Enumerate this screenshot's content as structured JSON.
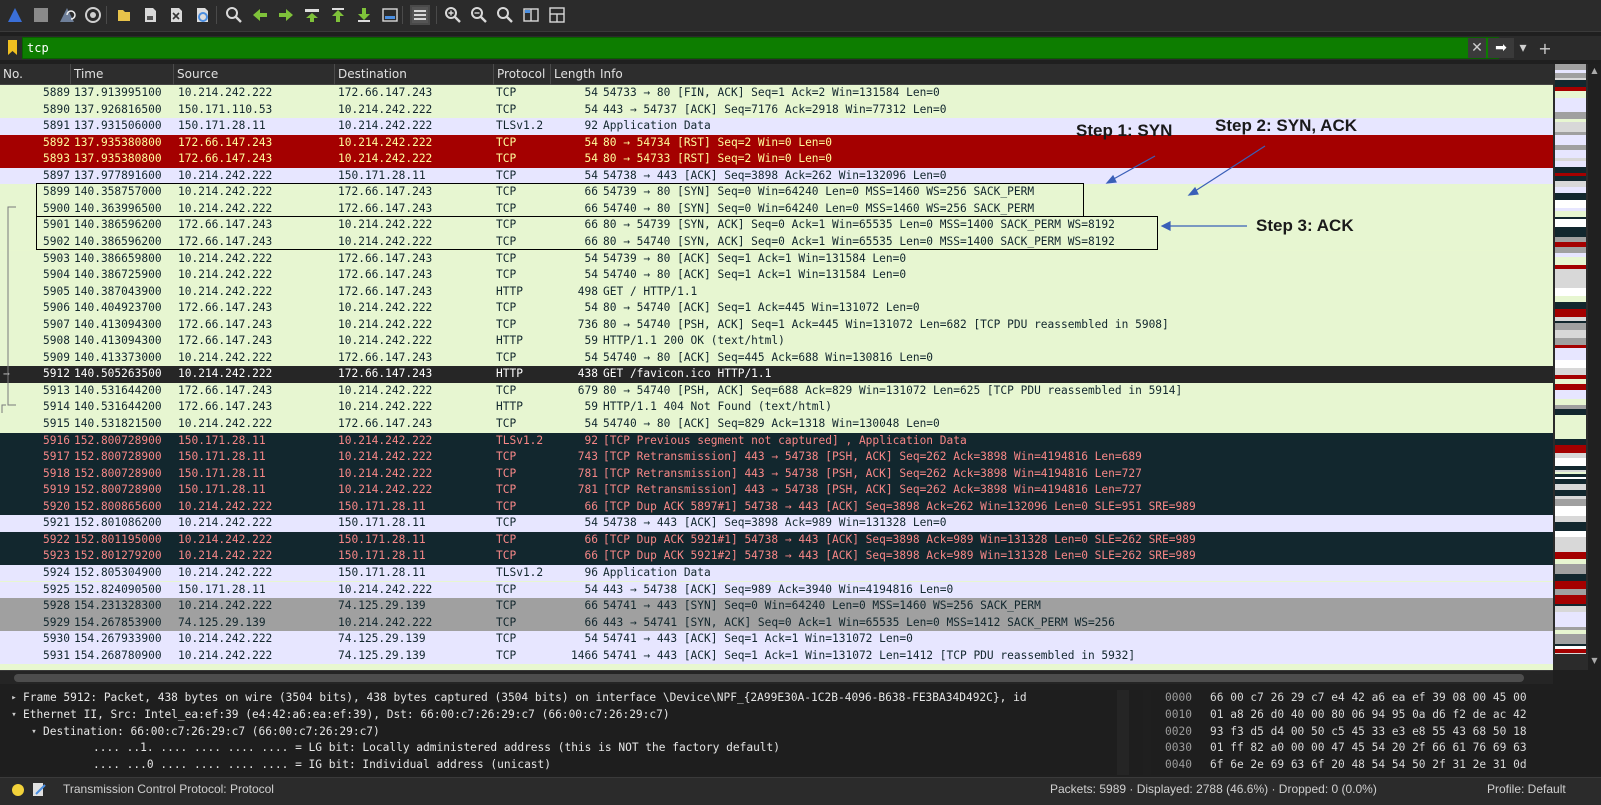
{
  "toolbar": {
    "buttons": [
      {
        "name": "start-capture-icon",
        "glyph": "",
        "color": "#3a6fd8"
      },
      {
        "name": "stop-capture-icon",
        "glyph": "",
        "color": "#8a8a8a"
      },
      {
        "name": "restart-capture-icon",
        "glyph": "",
        "color": "#6e7f9a"
      },
      {
        "name": "capture-options-icon",
        "glyph": "",
        "color": "#cfcfcf"
      },
      {
        "name": "open-file-icon",
        "glyph": "",
        "color": "#e8c34a"
      },
      {
        "name": "save-file-icon",
        "glyph": "",
        "color": "#d9d9d9"
      },
      {
        "name": "close-file-icon",
        "glyph": "",
        "color": "#d9d9d9"
      },
      {
        "name": "reload-file-icon",
        "glyph": "",
        "color": "#4a8ee0"
      },
      {
        "name": "find-packet-icon",
        "glyph": "",
        "color": "#d9d9d9"
      },
      {
        "name": "go-back-icon",
        "glyph": "",
        "color": "#7fc23a"
      },
      {
        "name": "go-forward-icon",
        "glyph": "",
        "color": "#7fc23a"
      },
      {
        "name": "go-to-packet-icon",
        "glyph": "",
        "color": "#7fc23a"
      },
      {
        "name": "go-first-packet-icon",
        "glyph": "",
        "color": "#7fc23a"
      },
      {
        "name": "go-last-packet-icon",
        "glyph": "",
        "color": "#7fc23a"
      },
      {
        "name": "auto-scroll-icon",
        "glyph": "",
        "color": "#d9d9d9"
      },
      {
        "name": "colorize-icon",
        "glyph": "",
        "color": "#d9d9d9"
      },
      {
        "name": "zoom-in-icon",
        "glyph": "",
        "color": "#d9d9d9"
      },
      {
        "name": "zoom-out-icon",
        "glyph": "",
        "color": "#d9d9d9"
      },
      {
        "name": "zoom-normal-icon",
        "glyph": "",
        "color": "#d9d9d9"
      },
      {
        "name": "resize-columns-icon",
        "glyph": "",
        "color": "#d9d9d9"
      },
      {
        "name": "layout-icon",
        "glyph": "",
        "color": "#d9d9d9"
      }
    ]
  },
  "filter": {
    "value": "tcp",
    "clear_glyph": "✕",
    "apply_glyph": "➡",
    "dropdown_glyph": "▾",
    "add_glyph": "+"
  },
  "columns": {
    "no": "No.",
    "time": "Time",
    "source": "Source",
    "destination": "Destination",
    "protocol": "Protocol",
    "length": "Length",
    "info": "Info"
  },
  "packets": [
    {
      "no": "5889",
      "time": "137.913995100",
      "src": "10.214.242.222",
      "dst": "172.66.147.243",
      "proto": "TCP",
      "len": "54",
      "info": "54733 → 80 [FIN, ACK] Seq=1 Ack=2 Win=131584 Len=0",
      "style": "tcp"
    },
    {
      "no": "5890",
      "time": "137.926816500",
      "src": "150.171.110.53",
      "dst": "10.214.242.222",
      "proto": "TCP",
      "len": "54",
      "info": "443 → 54737 [ACK] Seq=7176 Ack=2918 Win=77312 Len=0",
      "style": "tcp"
    },
    {
      "no": "5891",
      "time": "137.931506000",
      "src": "150.171.28.11",
      "dst": "10.214.242.222",
      "proto": "TLSv1.2",
      "len": "92",
      "info": "Application Data",
      "style": "tls"
    },
    {
      "no": "5892",
      "time": "137.935380800",
      "src": "172.66.147.243",
      "dst": "10.214.242.222",
      "proto": "TCP",
      "len": "54",
      "info": "80 → 54734 [RST] Seq=2 Win=0 Len=0",
      "style": "rst"
    },
    {
      "no": "5893",
      "time": "137.935380800",
      "src": "172.66.147.243",
      "dst": "10.214.242.222",
      "proto": "TCP",
      "len": "54",
      "info": "80 → 54733 [RST] Seq=2 Win=0 Len=0",
      "style": "rst"
    },
    {
      "no": "5897",
      "time": "137.977891600",
      "src": "10.214.242.222",
      "dst": "150.171.28.11",
      "proto": "TCP",
      "len": "54",
      "info": "54738 → 443 [ACK] Seq=3898 Ack=262 Win=132096 Len=0",
      "style": "tls"
    },
    {
      "no": "5899",
      "time": "140.358757000",
      "src": "10.214.242.222",
      "dst": "172.66.147.243",
      "proto": "TCP",
      "len": "66",
      "info": "54739 → 80 [SYN] Seq=0 Win=64240 Len=0 MSS=1460 WS=256 SACK_PERM",
      "style": "tcp"
    },
    {
      "no": "5900",
      "time": "140.363996500",
      "src": "10.214.242.222",
      "dst": "172.66.147.243",
      "proto": "TCP",
      "len": "66",
      "info": "54740 → 80 [SYN] Seq=0 Win=64240 Len=0 MSS=1460 WS=256 SACK_PERM",
      "style": "tcp"
    },
    {
      "no": "5901",
      "time": "140.386596200",
      "src": "172.66.147.243",
      "dst": "10.214.242.222",
      "proto": "TCP",
      "len": "66",
      "info": "80 → 54739 [SYN, ACK] Seq=0 Ack=1 Win=65535 Len=0 MSS=1400 SACK_PERM WS=8192",
      "style": "tcp"
    },
    {
      "no": "5902",
      "time": "140.386596200",
      "src": "172.66.147.243",
      "dst": "10.214.242.222",
      "proto": "TCP",
      "len": "66",
      "info": "80 → 54740 [SYN, ACK] Seq=0 Ack=1 Win=65535 Len=0 MSS=1400 SACK_PERM WS=8192",
      "style": "tcp"
    },
    {
      "no": "5903",
      "time": "140.386659800",
      "src": "10.214.242.222",
      "dst": "172.66.147.243",
      "proto": "TCP",
      "len": "54",
      "info": "54739 → 80 [ACK] Seq=1 Ack=1 Win=131584 Len=0",
      "style": "tcp"
    },
    {
      "no": "5904",
      "time": "140.386725900",
      "src": "10.214.242.222",
      "dst": "172.66.147.243",
      "proto": "TCP",
      "len": "54",
      "info": "54740 → 80 [ACK] Seq=1 Ack=1 Win=131584 Len=0",
      "style": "tcp"
    },
    {
      "no": "5905",
      "time": "140.387043900",
      "src": "10.214.242.222",
      "dst": "172.66.147.243",
      "proto": "HTTP",
      "len": "498",
      "info": "GET / HTTP/1.1",
      "style": "tcp"
    },
    {
      "no": "5906",
      "time": "140.404923700",
      "src": "172.66.147.243",
      "dst": "10.214.242.222",
      "proto": "TCP",
      "len": "54",
      "info": "80 → 54740 [ACK] Seq=1 Ack=445 Win=131072 Len=0",
      "style": "tcp"
    },
    {
      "no": "5907",
      "time": "140.413094300",
      "src": "172.66.147.243",
      "dst": "10.214.242.222",
      "proto": "TCP",
      "len": "736",
      "info": "80 → 54740 [PSH, ACK] Seq=1 Ack=445 Win=131072 Len=682 [TCP PDU reassembled in 5908]",
      "style": "tcp"
    },
    {
      "no": "5908",
      "time": "140.413094300",
      "src": "172.66.147.243",
      "dst": "10.214.242.222",
      "proto": "HTTP",
      "len": "59",
      "info": "HTTP/1.1 200 OK  (text/html)",
      "style": "tcp"
    },
    {
      "no": "5909",
      "time": "140.413373000",
      "src": "10.214.242.222",
      "dst": "172.66.147.243",
      "proto": "TCP",
      "len": "54",
      "info": "54740 → 80 [ACK] Seq=445 Ack=688 Win=130816 Len=0",
      "style": "tcp"
    },
    {
      "no": "5912",
      "time": "140.505263500",
      "src": "10.214.242.222",
      "dst": "172.66.147.243",
      "proto": "HTTP",
      "len": "438",
      "info": "GET /favicon.ico HTTP/1.1",
      "style": "sel"
    },
    {
      "no": "5913",
      "time": "140.531644200",
      "src": "172.66.147.243",
      "dst": "10.214.242.222",
      "proto": "TCP",
      "len": "679",
      "info": "80 → 54740 [PSH, ACK] Seq=688 Ack=829 Win=131072 Len=625 [TCP PDU reassembled in 5914]",
      "style": "tcp"
    },
    {
      "no": "5914",
      "time": "140.531644200",
      "src": "172.66.147.243",
      "dst": "10.214.242.222",
      "proto": "HTTP",
      "len": "59",
      "info": "HTTP/1.1 404 Not Found  (text/html)",
      "style": "tcp"
    },
    {
      "no": "5915",
      "time": "140.531821500",
      "src": "10.214.242.222",
      "dst": "172.66.147.243",
      "proto": "TCP",
      "len": "54",
      "info": "54740 → 80 [ACK] Seq=829 Ack=1318 Win=130048 Len=0",
      "style": "tcp"
    },
    {
      "no": "5916",
      "time": "152.800728900",
      "src": "150.171.28.11",
      "dst": "10.214.242.222",
      "proto": "TLSv1.2",
      "len": "92",
      "info": "[TCP Previous segment not captured] , Application Data",
      "style": "bad"
    },
    {
      "no": "5917",
      "time": "152.800728900",
      "src": "150.171.28.11",
      "dst": "10.214.242.222",
      "proto": "TCP",
      "len": "743",
      "info": "[TCP Retransmission] 443 → 54738 [PSH, ACK] Seq=262 Ack=3898 Win=4194816 Len=689",
      "style": "bad"
    },
    {
      "no": "5918",
      "time": "152.800728900",
      "src": "150.171.28.11",
      "dst": "10.214.242.222",
      "proto": "TCP",
      "len": "781",
      "info": "[TCP Retransmission] 443 → 54738 [PSH, ACK] Seq=262 Ack=3898 Win=4194816 Len=727",
      "style": "bad"
    },
    {
      "no": "5919",
      "time": "152.800728900",
      "src": "150.171.28.11",
      "dst": "10.214.242.222",
      "proto": "TCP",
      "len": "781",
      "info": "[TCP Retransmission] 443 → 54738 [PSH, ACK] Seq=262 Ack=3898 Win=4194816 Len=727",
      "style": "bad"
    },
    {
      "no": "5920",
      "time": "152.800865600",
      "src": "10.214.242.222",
      "dst": "150.171.28.11",
      "proto": "TCP",
      "len": "66",
      "info": "[TCP Dup ACK 5897#1] 54738 → 443 [ACK] Seq=3898 Ack=262 Win=132096 Len=0 SLE=951 SRE=989",
      "style": "bad"
    },
    {
      "no": "5921",
      "time": "152.801086200",
      "src": "10.214.242.222",
      "dst": "150.171.28.11",
      "proto": "TCP",
      "len": "54",
      "info": "54738 → 443 [ACK] Seq=3898 Ack=989 Win=131328 Len=0",
      "style": "tls"
    },
    {
      "no": "5922",
      "time": "152.801195000",
      "src": "10.214.242.222",
      "dst": "150.171.28.11",
      "proto": "TCP",
      "len": "66",
      "info": "[TCP Dup ACK 5921#1] 54738 → 443 [ACK] Seq=3898 Ack=989 Win=131328 Len=0 SLE=262 SRE=989",
      "style": "bad"
    },
    {
      "no": "5923",
      "time": "152.801279200",
      "src": "10.214.242.222",
      "dst": "150.171.28.11",
      "proto": "TCP",
      "len": "66",
      "info": "[TCP Dup ACK 5921#2] 54738 → 443 [ACK] Seq=3898 Ack=989 Win=131328 Len=0 SLE=262 SRE=989",
      "style": "bad"
    },
    {
      "no": "5924",
      "time": "152.805304900",
      "src": "10.214.242.222",
      "dst": "150.171.28.11",
      "proto": "TLSv1.2",
      "len": "96",
      "info": "Application Data",
      "style": "tls"
    },
    {
      "no": "5925",
      "time": "152.824090500",
      "src": "150.171.28.11",
      "dst": "10.214.242.222",
      "proto": "TCP",
      "len": "54",
      "info": "443 → 54738 [ACK] Seq=989 Ack=3940 Win=4194816 Len=0",
      "style": "tls"
    },
    {
      "no": "5928",
      "time": "154.231328300",
      "src": "10.214.242.222",
      "dst": "74.125.29.139",
      "proto": "TCP",
      "len": "66",
      "info": "54741 → 443 [SYN] Seq=0 Win=64240 Len=0 MSS=1460 WS=256 SACK_PERM",
      "style": "gray"
    },
    {
      "no": "5929",
      "time": "154.267853900",
      "src": "74.125.29.139",
      "dst": "10.214.242.222",
      "proto": "TCP",
      "len": "66",
      "info": "443 → 54741 [SYN, ACK] Seq=0 Ack=1 Win=65535 Len=0 MSS=1412 SACK_PERM WS=256",
      "style": "gray"
    },
    {
      "no": "5930",
      "time": "154.267933900",
      "src": "10.214.242.222",
      "dst": "74.125.29.139",
      "proto": "TCP",
      "len": "54",
      "info": "54741 → 443 [ACK] Seq=1 Ack=1 Win=131072 Len=0",
      "style": "tls"
    },
    {
      "no": "5931",
      "time": "154.268780900",
      "src": "10.214.242.222",
      "dst": "74.125.29.139",
      "proto": "TCP",
      "len": "1466",
      "info": "54741 → 443 [ACK] Seq=1 Ack=1 Win=131072 Len=1412 [TCP PDU reassembled in 5932]",
      "style": "tls"
    }
  ],
  "annotations": {
    "step1": "Step 1: SYN",
    "step2": "Step 2: SYN, ACK",
    "step3": "Step 3: ACK"
  },
  "details": [
    {
      "twisty": "▸",
      "indent": 0,
      "text": "Frame 5912: Packet, 438 bytes on wire (3504 bits), 438 bytes captured (3504 bits) on interface \\Device\\NPF_{2A99E30A-1C2B-4096-B638-FE3BA34D492C}, id"
    },
    {
      "twisty": "▾",
      "indent": 0,
      "text": "Ethernet II, Src: Intel_ea:ef:39 (e4:42:a6:ea:ef:39), Dst: 66:00:c7:26:29:c7 (66:00:c7:26:29:c7)"
    },
    {
      "twisty": "▾",
      "indent": 1,
      "text": "Destination: 66:00:c7:26:29:c7 (66:00:c7:26:29:c7)"
    },
    {
      "twisty": "",
      "indent": 2,
      "text": ".... ..1. .... .... .... .... = LG bit: Locally administered address (this is NOT the factory default)"
    },
    {
      "twisty": "",
      "indent": 2,
      "text": ".... ...0 .... .... .... .... = IG bit: Individual address (unicast)"
    }
  ],
  "bytes": [
    {
      "offset": "0000",
      "hex": "66 00 c7 26 29 c7 e4 42  a6 ea ef 39 08 00 45 00"
    },
    {
      "offset": "0010",
      "hex": "01 a8 26 d0 40 00 80 06  94 95 0a d6 f2 de ac 42"
    },
    {
      "offset": "0020",
      "hex": "93 f3 d5 d4 00 50 c5 45  33 e3 e8 55 43 68 50 18"
    },
    {
      "offset": "0030",
      "hex": "01 ff 82 a0 00 00 47 45  54 20 2f 66 61 76 69 63"
    },
    {
      "offset": "0040",
      "hex": "6f 6e 2e 69 63 6f 20 48  54 54 50 2f 31 2e 31 0d"
    }
  ],
  "status": {
    "field": "Transmission Control Protocol: Protocol",
    "counts": "Packets: 5989 · Displayed: 2788 (46.6%) · Dropped: 0 (0.0%)",
    "profile": "Profile: Default"
  },
  "colors": {
    "filter_ok": "#0d7d00",
    "tcp_row": "#e7f6d1",
    "rst_row": "#a40000",
    "bad_row": "#12272e",
    "selected_row": "#262626"
  }
}
